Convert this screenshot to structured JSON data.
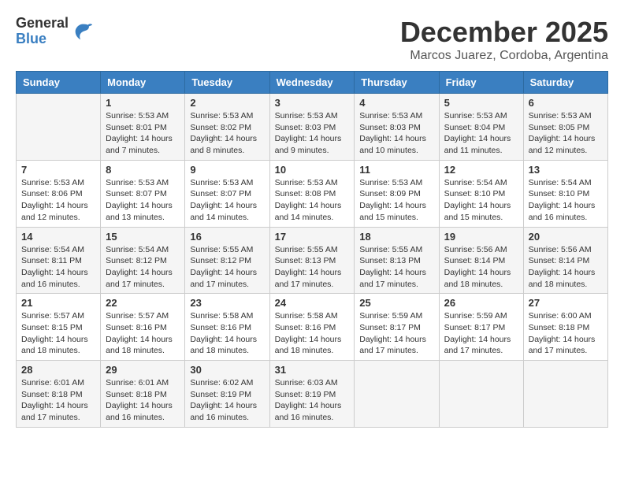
{
  "header": {
    "logo_general": "General",
    "logo_blue": "Blue",
    "month_title": "December 2025",
    "location": "Marcos Juarez, Cordoba, Argentina"
  },
  "days_of_week": [
    "Sunday",
    "Monday",
    "Tuesday",
    "Wednesday",
    "Thursday",
    "Friday",
    "Saturday"
  ],
  "weeks": [
    [
      {
        "day": "",
        "info": ""
      },
      {
        "day": "1",
        "info": "Sunrise: 5:53 AM\nSunset: 8:01 PM\nDaylight: 14 hours\nand 7 minutes."
      },
      {
        "day": "2",
        "info": "Sunrise: 5:53 AM\nSunset: 8:02 PM\nDaylight: 14 hours\nand 8 minutes."
      },
      {
        "day": "3",
        "info": "Sunrise: 5:53 AM\nSunset: 8:03 PM\nDaylight: 14 hours\nand 9 minutes."
      },
      {
        "day": "4",
        "info": "Sunrise: 5:53 AM\nSunset: 8:03 PM\nDaylight: 14 hours\nand 10 minutes."
      },
      {
        "day": "5",
        "info": "Sunrise: 5:53 AM\nSunset: 8:04 PM\nDaylight: 14 hours\nand 11 minutes."
      },
      {
        "day": "6",
        "info": "Sunrise: 5:53 AM\nSunset: 8:05 PM\nDaylight: 14 hours\nand 12 minutes."
      }
    ],
    [
      {
        "day": "7",
        "info": "Sunrise: 5:53 AM\nSunset: 8:06 PM\nDaylight: 14 hours\nand 12 minutes."
      },
      {
        "day": "8",
        "info": "Sunrise: 5:53 AM\nSunset: 8:07 PM\nDaylight: 14 hours\nand 13 minutes."
      },
      {
        "day": "9",
        "info": "Sunrise: 5:53 AM\nSunset: 8:07 PM\nDaylight: 14 hours\nand 14 minutes."
      },
      {
        "day": "10",
        "info": "Sunrise: 5:53 AM\nSunset: 8:08 PM\nDaylight: 14 hours\nand 14 minutes."
      },
      {
        "day": "11",
        "info": "Sunrise: 5:53 AM\nSunset: 8:09 PM\nDaylight: 14 hours\nand 15 minutes."
      },
      {
        "day": "12",
        "info": "Sunrise: 5:54 AM\nSunset: 8:10 PM\nDaylight: 14 hours\nand 15 minutes."
      },
      {
        "day": "13",
        "info": "Sunrise: 5:54 AM\nSunset: 8:10 PM\nDaylight: 14 hours\nand 16 minutes."
      }
    ],
    [
      {
        "day": "14",
        "info": "Sunrise: 5:54 AM\nSunset: 8:11 PM\nDaylight: 14 hours\nand 16 minutes."
      },
      {
        "day": "15",
        "info": "Sunrise: 5:54 AM\nSunset: 8:12 PM\nDaylight: 14 hours\nand 17 minutes."
      },
      {
        "day": "16",
        "info": "Sunrise: 5:55 AM\nSunset: 8:12 PM\nDaylight: 14 hours\nand 17 minutes."
      },
      {
        "day": "17",
        "info": "Sunrise: 5:55 AM\nSunset: 8:13 PM\nDaylight: 14 hours\nand 17 minutes."
      },
      {
        "day": "18",
        "info": "Sunrise: 5:55 AM\nSunset: 8:13 PM\nDaylight: 14 hours\nand 17 minutes."
      },
      {
        "day": "19",
        "info": "Sunrise: 5:56 AM\nSunset: 8:14 PM\nDaylight: 14 hours\nand 18 minutes."
      },
      {
        "day": "20",
        "info": "Sunrise: 5:56 AM\nSunset: 8:14 PM\nDaylight: 14 hours\nand 18 minutes."
      }
    ],
    [
      {
        "day": "21",
        "info": "Sunrise: 5:57 AM\nSunset: 8:15 PM\nDaylight: 14 hours\nand 18 minutes."
      },
      {
        "day": "22",
        "info": "Sunrise: 5:57 AM\nSunset: 8:16 PM\nDaylight: 14 hours\nand 18 minutes."
      },
      {
        "day": "23",
        "info": "Sunrise: 5:58 AM\nSunset: 8:16 PM\nDaylight: 14 hours\nand 18 minutes."
      },
      {
        "day": "24",
        "info": "Sunrise: 5:58 AM\nSunset: 8:16 PM\nDaylight: 14 hours\nand 18 minutes."
      },
      {
        "day": "25",
        "info": "Sunrise: 5:59 AM\nSunset: 8:17 PM\nDaylight: 14 hours\nand 17 minutes."
      },
      {
        "day": "26",
        "info": "Sunrise: 5:59 AM\nSunset: 8:17 PM\nDaylight: 14 hours\nand 17 minutes."
      },
      {
        "day": "27",
        "info": "Sunrise: 6:00 AM\nSunset: 8:18 PM\nDaylight: 14 hours\nand 17 minutes."
      }
    ],
    [
      {
        "day": "28",
        "info": "Sunrise: 6:01 AM\nSunset: 8:18 PM\nDaylight: 14 hours\nand 17 minutes."
      },
      {
        "day": "29",
        "info": "Sunrise: 6:01 AM\nSunset: 8:18 PM\nDaylight: 14 hours\nand 16 minutes."
      },
      {
        "day": "30",
        "info": "Sunrise: 6:02 AM\nSunset: 8:19 PM\nDaylight: 14 hours\nand 16 minutes."
      },
      {
        "day": "31",
        "info": "Sunrise: 6:03 AM\nSunset: 8:19 PM\nDaylight: 14 hours\nand 16 minutes."
      },
      {
        "day": "",
        "info": ""
      },
      {
        "day": "",
        "info": ""
      },
      {
        "day": "",
        "info": ""
      }
    ]
  ]
}
